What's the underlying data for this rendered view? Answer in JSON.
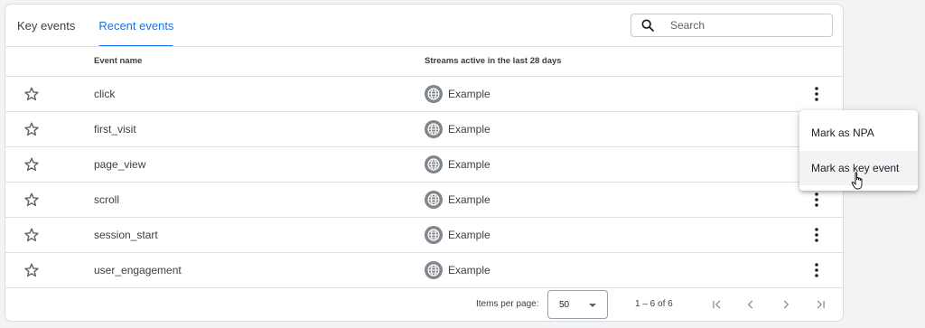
{
  "tabs": [
    {
      "label": "Key events",
      "active": false
    },
    {
      "label": "Recent events",
      "active": true
    }
  ],
  "search": {
    "placeholder": "Search",
    "value": ""
  },
  "table": {
    "headers": {
      "event_name": "Event name",
      "streams": "Streams active in the last 28 days"
    },
    "rows": [
      {
        "event": "click",
        "stream": "Example"
      },
      {
        "event": "first_visit",
        "stream": "Example"
      },
      {
        "event": "page_view",
        "stream": "Example"
      },
      {
        "event": "scroll",
        "stream": "Example"
      },
      {
        "event": "session_start",
        "stream": "Example"
      },
      {
        "event": "user_engagement",
        "stream": "Example"
      }
    ]
  },
  "footer": {
    "items_per_page_label": "Items per page:",
    "items_per_page_value": "50",
    "range": "1 – 6 of 6"
  },
  "context_menu": {
    "items": [
      "Mark as NPA",
      "Mark as key event"
    ]
  },
  "icons": {
    "search": "search-icon",
    "star": "star-outline-icon",
    "globe": "globe-icon",
    "more": "more-vert-icon",
    "first_page": "first-page-icon",
    "prev": "chevron-left-icon",
    "next": "chevron-right-icon",
    "last_page": "last-page-icon"
  },
  "colors": {
    "accent": "#1a73e8",
    "text": "#3c4043",
    "border": "#dadce0"
  }
}
